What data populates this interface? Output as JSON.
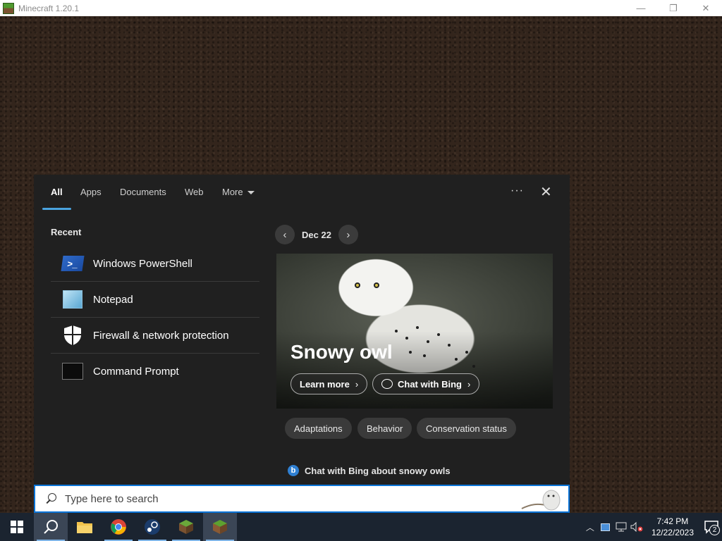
{
  "window": {
    "title": "Minecraft 1.20.1",
    "buttons": {
      "minimize": "—",
      "restore": "❐",
      "close": "✕"
    }
  },
  "search_panel": {
    "tabs": [
      {
        "label": "All",
        "active": true
      },
      {
        "label": "Apps",
        "active": false
      },
      {
        "label": "Documents",
        "active": false
      },
      {
        "label": "Web",
        "active": false
      },
      {
        "label": "More",
        "active": false
      }
    ],
    "options_icon": "···",
    "close_icon": "✕",
    "recent": {
      "heading": "Recent",
      "items": [
        {
          "label": "Windows PowerShell",
          "icon": "powershell-icon"
        },
        {
          "label": "Notepad",
          "icon": "notepad-icon"
        },
        {
          "label": "Firewall & network protection",
          "icon": "shield-icon"
        },
        {
          "label": "Command Prompt",
          "icon": "command-prompt-icon"
        }
      ]
    },
    "highlight": {
      "date": "Dec 22",
      "prev_icon": "‹",
      "next_icon": "›",
      "title": "Snowy owl",
      "learn_more": "Learn more",
      "chat_with_bing": "Chat with Bing",
      "chips": [
        "Adaptations",
        "Behavior",
        "Conservation status"
      ],
      "bing_prompt": "Chat with Bing about snowy owls"
    }
  },
  "search_box": {
    "placeholder": "Type here to search",
    "value": ""
  },
  "taskbar": {
    "items": [
      {
        "name": "start-icon"
      },
      {
        "name": "search-icon",
        "active": true
      },
      {
        "name": "file-explorer-icon"
      },
      {
        "name": "chrome-icon"
      },
      {
        "name": "steam-icon"
      },
      {
        "name": "minecraft-launcher-icon"
      },
      {
        "name": "minecraft-icon"
      }
    ],
    "clock": {
      "time": "7:42 PM",
      "date": "12/22/2023"
    },
    "notification_count": "2"
  },
  "colors": {
    "accent": "#0a74d8",
    "tab_underline": "#4aa3df",
    "panel_bg": "#202020",
    "taskbar_bg": "#1b2430"
  }
}
